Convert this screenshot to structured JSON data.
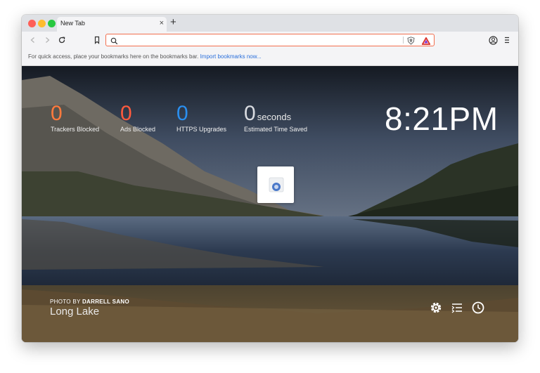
{
  "tab": {
    "title": "New Tab",
    "close": "×",
    "new": "+"
  },
  "toolbar": {
    "url_value": "",
    "icons": [
      "back-icon",
      "forward-icon",
      "reload-icon",
      "bookmark-icon",
      "search-icon",
      "brave-shields-icon",
      "brave-rewards-icon",
      "profile-icon",
      "menu-icon"
    ]
  },
  "bookmarks_bar": {
    "message": "For quick access, place your bookmarks here on the bookmarks bar.",
    "link": "Import bookmarks now..."
  },
  "stats": [
    {
      "value": "0",
      "unit": "",
      "label": "Trackers Blocked",
      "color": "#ff7a3d"
    },
    {
      "value": "0",
      "unit": "",
      "label": "Ads Blocked",
      "color": "#ff5a3d"
    },
    {
      "value": "0",
      "unit": "",
      "label": "HTTPS Upgrades",
      "color": "#2a8ff0"
    },
    {
      "value": "0",
      "unit": "seconds",
      "label": "Estimated Time Saved",
      "color": "#ffffff"
    }
  ],
  "clock": "8:21PM",
  "photo": {
    "prefix": "PHOTO BY",
    "author": "DARRELL SANO",
    "location": "Long Lake"
  },
  "bottom_icons": [
    "settings-icon",
    "customize-icon",
    "history-icon"
  ],
  "colors": {
    "accent": "#f26e4e",
    "link": "#2a6fdb"
  }
}
